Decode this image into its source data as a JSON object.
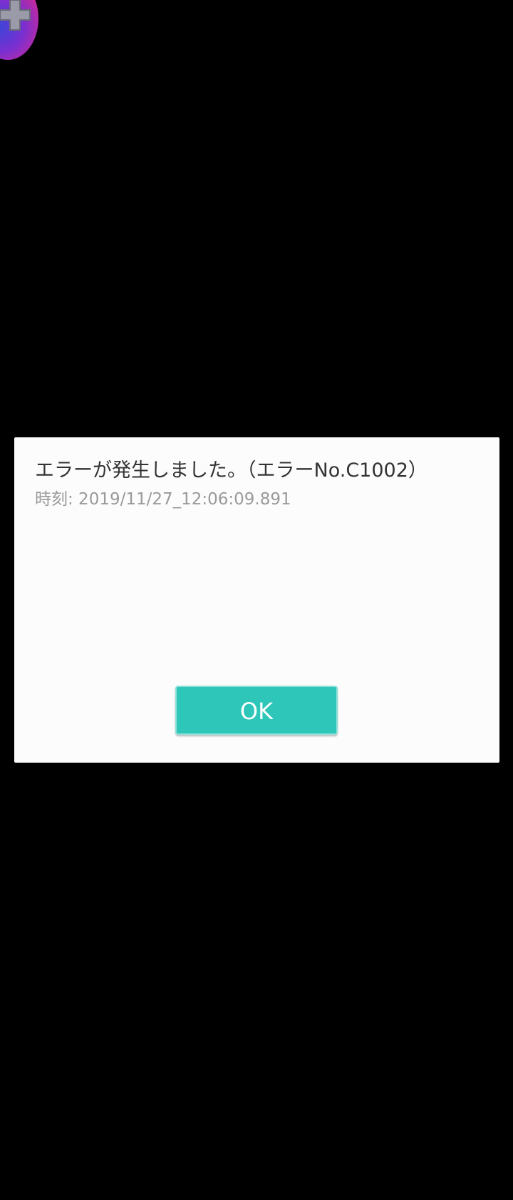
{
  "overlay_button": {
    "icon": "dpad-icon",
    "gradient_colors": [
      "#3b45d8",
      "#7a2fd0",
      "#c22aa0",
      "#d82a7a"
    ]
  },
  "dialog": {
    "message": "エラーが発生しました。（エラーNo.C1002）",
    "timestamp": "時刻: 2019/11/27_12:06:09.891",
    "ok_label": "OK",
    "button_color": "#2ec6b8",
    "background_color": "#fcfcfc"
  }
}
